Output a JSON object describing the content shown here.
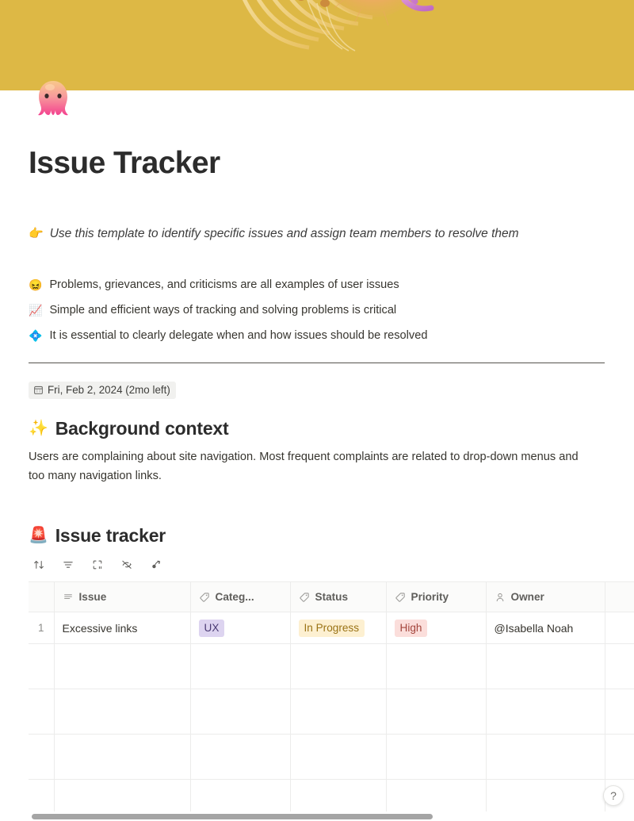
{
  "cover": {
    "background_color": "#ddb845",
    "art_name": "abstract-organic-gold-illustration"
  },
  "page": {
    "icon_emoji": "🐙",
    "icon_name": "octopus-emoji",
    "title": "Issue Tracker"
  },
  "intro": {
    "emoji": "👉",
    "text": "Use this template to identify specific issues and assign team members to resolve them"
  },
  "bullets": [
    {
      "emoji": "😖",
      "text": "Problems, grievances, and criticisms are all examples of user issues"
    },
    {
      "emoji": "📈",
      "text": "Simple and efficient ways of tracking and solving problems is critical"
    },
    {
      "emoji": "💠",
      "text": "It is essential to clearly delegate when and how issues should be resolved"
    }
  ],
  "date": {
    "icon": "calendar-icon",
    "label": "Fri, Feb 2, 2024 (2mo left)"
  },
  "background_section": {
    "emoji": "✨",
    "heading": "Background context",
    "body": "Users are complaining about site navigation. Most frequent complaints are related to drop-down menus and too many navigation links."
  },
  "tracker_section": {
    "emoji": "🚨",
    "heading": "Issue tracker"
  },
  "db_toolbar": {
    "buttons": [
      {
        "name": "sort-icon",
        "title": "Sort"
      },
      {
        "name": "filter-icon",
        "title": "Filter"
      },
      {
        "name": "layout-icon",
        "title": "Layout"
      },
      {
        "name": "hide-eye-icon",
        "title": "Hidden properties"
      },
      {
        "name": "automation-icon",
        "title": "Automations"
      }
    ]
  },
  "table": {
    "columns": [
      {
        "label": "Issue",
        "icon": "text-lines-icon"
      },
      {
        "label": "Categ...",
        "icon": "tag-icon"
      },
      {
        "label": "Status",
        "icon": "tag-icon"
      },
      {
        "label": "Priority",
        "icon": "tag-icon"
      },
      {
        "label": "Owner",
        "icon": "person-icon"
      }
    ],
    "rows": [
      {
        "number": "1",
        "issue": "Excessive links",
        "category": "UX",
        "status": "In Progress",
        "priority": "High",
        "owner": "@Isabella Noah"
      }
    ]
  },
  "colors": {
    "cover": "#ddb845",
    "badge_ux_bg": "#ddd4f0",
    "badge_ux_text": "#4a3a73",
    "badge_status_bg": "#fdf0d1",
    "badge_status_text": "#9a7315",
    "badge_priority_bg": "#fbdedb",
    "badge_priority_text": "#a3453c"
  },
  "help": {
    "label": "?"
  },
  "scrollbar": {
    "orientation": "horizontal"
  }
}
